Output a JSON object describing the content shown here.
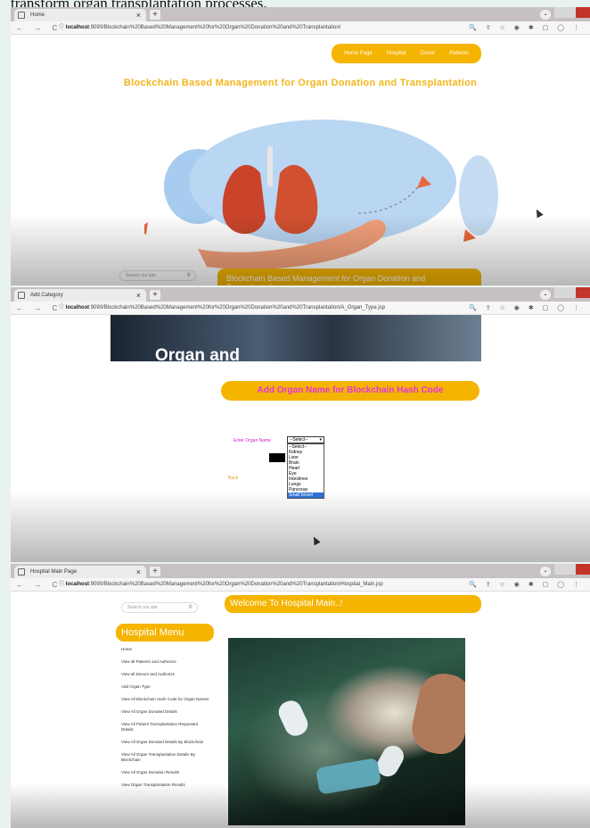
{
  "caption": "transform organ transplantation processes.",
  "browser": {
    "close_glyph": "×",
    "new_tab_glyph": "+",
    "nav_glyphs": "← → C",
    "info_glyph": "ⓘ",
    "tool_glyphs": "🔍 ⇪ ☆ ◉ ✱ ▢ ◯ ⋮",
    "profile_glyph": "⌄"
  },
  "screen1": {
    "tab_title": "Home",
    "url_host": "localhost",
    "url_path": ":9090/Blockchain%20Based%20Management%20for%20Organ%20Donation%20and%20Transplantation/",
    "nav_items": [
      "Home Page",
      "Hospital",
      "Donor",
      "Patients"
    ],
    "title": "Blockchain Based Management for Organ Donation and Transplantation",
    "search_placeholder": "Search our site",
    "banner": "Blockchain Based Management for Organ Donation and Transplantation",
    "colors": {
      "accent": "#f5b400",
      "lungs": "#c9442b",
      "hand": "#f3a07a",
      "blob": "#9fc5ee",
      "arrow": "#e8693b"
    }
  },
  "screen2": {
    "tab_title": "Add Category",
    "url_host": "localhost",
    "url_path": ":9090/Blockchain%20Based%20Management%20for%20Organ%20Donation%20and%20Transplantation/A_Organ_Type.jsp",
    "hero_text": "Organ and",
    "banner": "Add Organ Name for Blockchain Hash Code",
    "field_label": "Enter Organ Name",
    "select_value": "--Select--",
    "options": [
      "--Select--",
      "Kidney",
      "Liver",
      "Brain",
      "Heart",
      "Eye",
      "Intestines",
      "Lungs",
      "Pancreas",
      "Small bowel"
    ],
    "highlighted_option": "Small bowel",
    "back_link": "Back",
    "colors": {
      "banner_text": "#e533e0",
      "label": "#d422c8"
    }
  },
  "screen3": {
    "tab_title": "Hospital Main Page",
    "url_host": "localhost",
    "url_path": ":9090/Blockchain%20Based%20Management%20for%20Organ%20Donation%20and%20Transplantation/Hospital_Main.jsp",
    "search_placeholder": "Search our site",
    "welcome": "Welcome To Hospital Main..!",
    "menu_title": "Hospital Menu",
    "menu_items": [
      "Home",
      "View all Patients and Authorize",
      "View all Donors and Authorize",
      "Add Organ Type",
      "View All Blockchain Hash Code for Organ Names",
      "View All Organ Donated Details",
      "View All Patient Transplantation Requested Details",
      "View All Organ Donated Details By Blockchain",
      "View All Organ Transplantation Details By Blockchain",
      "View All Organ Donation Results",
      "View Organ Transplantation Results"
    ]
  }
}
